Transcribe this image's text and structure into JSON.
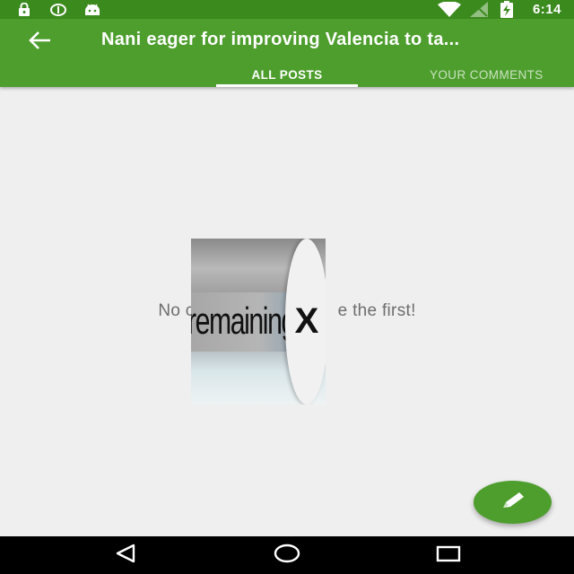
{
  "status_bar": {
    "time": "6:14",
    "left_icons": [
      "lock-icon",
      "sync-icon",
      "android-icon"
    ],
    "right_icons": [
      "wifi-icon",
      "no-signal-icon",
      "battery-charging-icon"
    ]
  },
  "app_bar": {
    "back_icon": "arrow-back-icon",
    "title": "Nani eager for improving Valencia to ta..."
  },
  "tabs": [
    {
      "label": "ALL POSTS",
      "active": true
    },
    {
      "label": "YOUR COMMENTS",
      "active": false
    }
  ],
  "content": {
    "empty_message": "No c",
    "empty_message_tail": "e the first!"
  },
  "ad_overlay": {
    "text": "remaining",
    "close_glyph": "X"
  },
  "fab": {
    "icon": "pencil-icon"
  },
  "nav_bar": {
    "icons": [
      "back-triangle-icon",
      "home-circle-icon",
      "recents-square-icon"
    ]
  },
  "colors": {
    "status_bar": "#3b8a1e",
    "primary": "#4e9e2e",
    "background": "#efefef",
    "nav_bar": "#000000"
  }
}
